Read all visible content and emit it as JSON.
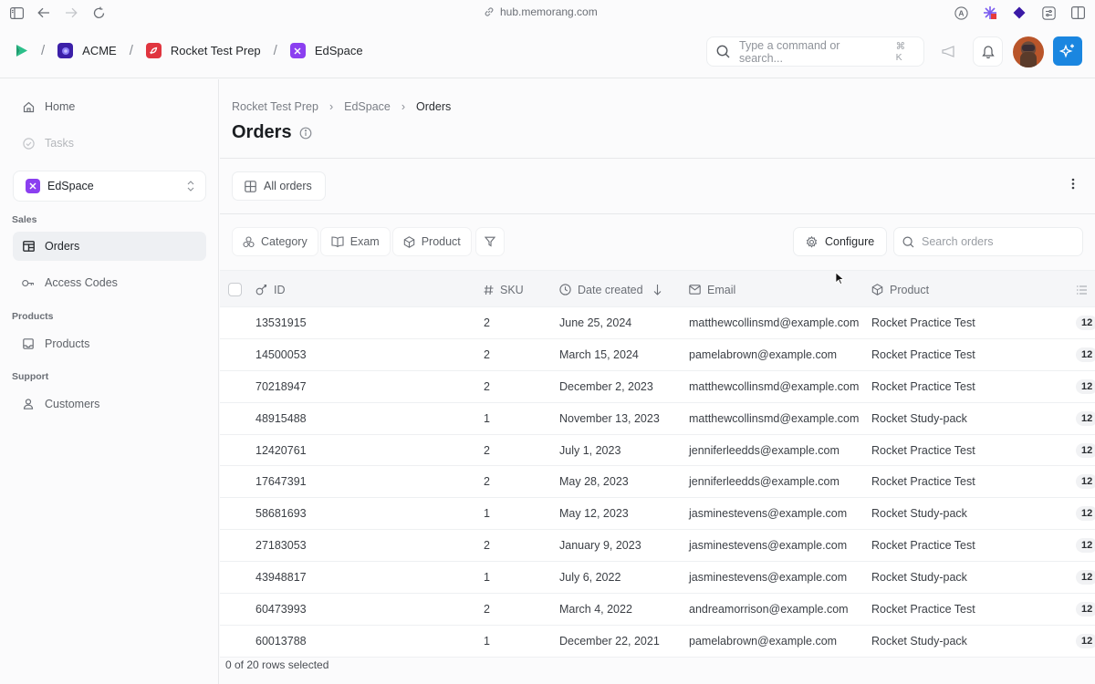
{
  "browser": {
    "url": "hub.memorang.com"
  },
  "header": {
    "breadcrumb": [
      {
        "label": "ACME",
        "icon": "acme-logo",
        "color": "#3b1fa8"
      },
      {
        "label": "Rocket Test Prep",
        "icon": "rocket-logo",
        "color": "#e0353f"
      },
      {
        "label": "EdSpace",
        "icon": "edspace-logo",
        "color": "#8b3ff0"
      }
    ],
    "command_search": {
      "placeholder": "Type a command or search...",
      "shortcut": "⌘ K"
    },
    "accent_color": "#1a86e0"
  },
  "sidebar": {
    "home": "Home",
    "tasks": "Tasks",
    "workspace": "EdSpace",
    "sections": [
      {
        "label": "Sales",
        "items": [
          {
            "label": "Orders",
            "icon": "orders-icon",
            "active": true
          },
          {
            "label": "Access Codes",
            "icon": "key-icon",
            "active": false
          }
        ]
      },
      {
        "label": "Products",
        "items": [
          {
            "label": "Products",
            "icon": "inbox-icon",
            "active": false
          }
        ]
      },
      {
        "label": "Support",
        "items": [
          {
            "label": "Customers",
            "icon": "user-icon",
            "active": false
          }
        ]
      }
    ]
  },
  "main": {
    "breadcrumb": [
      "Rocket Test Prep",
      "EdSpace",
      "Orders"
    ],
    "title": "Orders",
    "view_tab": "All orders",
    "filters": [
      "Category",
      "Exam",
      "Product"
    ],
    "configure_label": "Configure",
    "search_placeholder": "Search orders",
    "columns": [
      "ID",
      "SKU",
      "Date created",
      "Email",
      "Product"
    ],
    "rows": [
      {
        "id": "13531915",
        "sku": "2",
        "date": "June 25, 2024",
        "email": "matthewcollinsmd@example.com",
        "product": "Rocket Practice Test",
        "extra": "12"
      },
      {
        "id": "14500053",
        "sku": "2",
        "date": "March 15, 2024",
        "email": "pamelabrown@example.com",
        "product": "Rocket Practice Test",
        "extra": "12"
      },
      {
        "id": "70218947",
        "sku": "2",
        "date": "December 2, 2023",
        "email": "matthewcollinsmd@example.com",
        "product": "Rocket Practice Test",
        "extra": "12"
      },
      {
        "id": "48915488",
        "sku": "1",
        "date": "November 13, 2023",
        "email": "matthewcollinsmd@example.com",
        "product": "Rocket Study-pack",
        "extra": "12"
      },
      {
        "id": "12420761",
        "sku": "2",
        "date": "July 1, 2023",
        "email": "jenniferleedds@example.com",
        "product": "Rocket Practice Test",
        "extra": "12"
      },
      {
        "id": "17647391",
        "sku": "2",
        "date": "May 28, 2023",
        "email": "jenniferleedds@example.com",
        "product": "Rocket Practice Test",
        "extra": "12"
      },
      {
        "id": "58681693",
        "sku": "1",
        "date": "May 12, 2023",
        "email": "jasminestevens@example.com",
        "product": "Rocket Study-pack",
        "extra": "12"
      },
      {
        "id": "27183053",
        "sku": "2",
        "date": "January 9, 2023",
        "email": "jasminestevens@example.com",
        "product": "Rocket Practice Test",
        "extra": "12"
      },
      {
        "id": "43948817",
        "sku": "1",
        "date": "July 6, 2022",
        "email": "jasminestevens@example.com",
        "product": "Rocket Study-pack",
        "extra": "12"
      },
      {
        "id": "60473993",
        "sku": "2",
        "date": "March 4, 2022",
        "email": "andreamorrison@example.com",
        "product": "Rocket Practice Test",
        "extra": "12"
      },
      {
        "id": "60013788",
        "sku": "1",
        "date": "December 22, 2021",
        "email": "pamelabrown@example.com",
        "product": "Rocket Study-pack",
        "extra": "12"
      }
    ],
    "footer": "0 of 20 rows selected"
  }
}
